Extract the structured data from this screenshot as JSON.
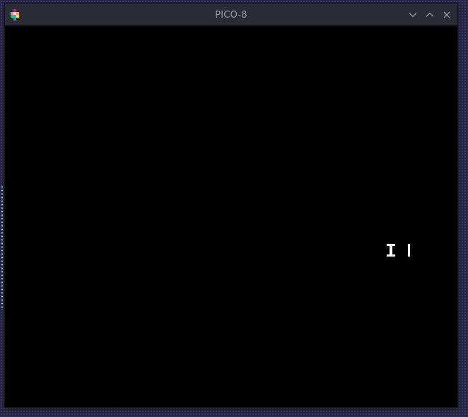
{
  "window": {
    "title": "PICO-8",
    "app_icon": "pico8-logo-icon",
    "controls": [
      {
        "name": "minimize-icon"
      },
      {
        "name": "maximize-icon"
      },
      {
        "name": "close-icon"
      }
    ]
  },
  "screen": {
    "background": "#000000",
    "glyph_color": "#ffffff"
  },
  "colors": {
    "titlebar": "#2a2c33",
    "title_text": "#9a9ca3",
    "desktop": "#262441"
  }
}
